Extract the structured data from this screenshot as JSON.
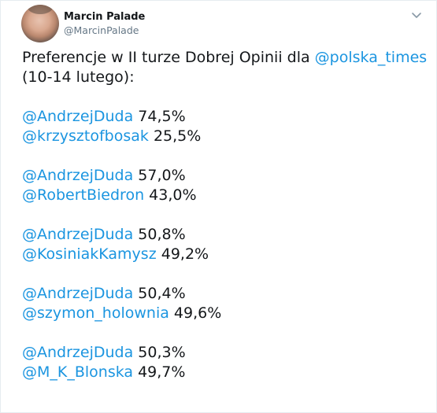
{
  "author": {
    "display_name": "Marcin Palade",
    "handle": "@MarcinPalade"
  },
  "tweet": {
    "intro_text": "Preferencje w II turze Dobrej Opinii dla ",
    "intro_mention": "@polska_times",
    "intro_date": " (10-14 lutego):",
    "results": [
      {
        "a_mention": "@AndrzejDuda",
        "a_value": " 74,5%",
        "b_mention": "@krzysztofbosak",
        "b_value": " 25,5%"
      },
      {
        "a_mention": "@AndrzejDuda",
        "a_value": " 57,0%",
        "b_mention": "@RobertBiedron",
        "b_value": " 43,0%"
      },
      {
        "a_mention": "@AndrzejDuda",
        "a_value": " 50,8%",
        "b_mention": "@KosiniakKamysz",
        "b_value": " 49,2%"
      },
      {
        "a_mention": "@AndrzejDuda",
        "a_value": " 50,4%",
        "b_mention": "@szymon_holownia",
        "b_value": " 49,6%"
      },
      {
        "a_mention": "@AndrzejDuda",
        "a_value": " 50,3%",
        "b_mention": "@M_K_Blonska",
        "b_value": " 49,7%"
      }
    ]
  },
  "icons": {
    "menu": "chevron-down-icon"
  },
  "colors": {
    "link": "#1b95e0",
    "text": "#14171a",
    "secondary": "#657786"
  }
}
